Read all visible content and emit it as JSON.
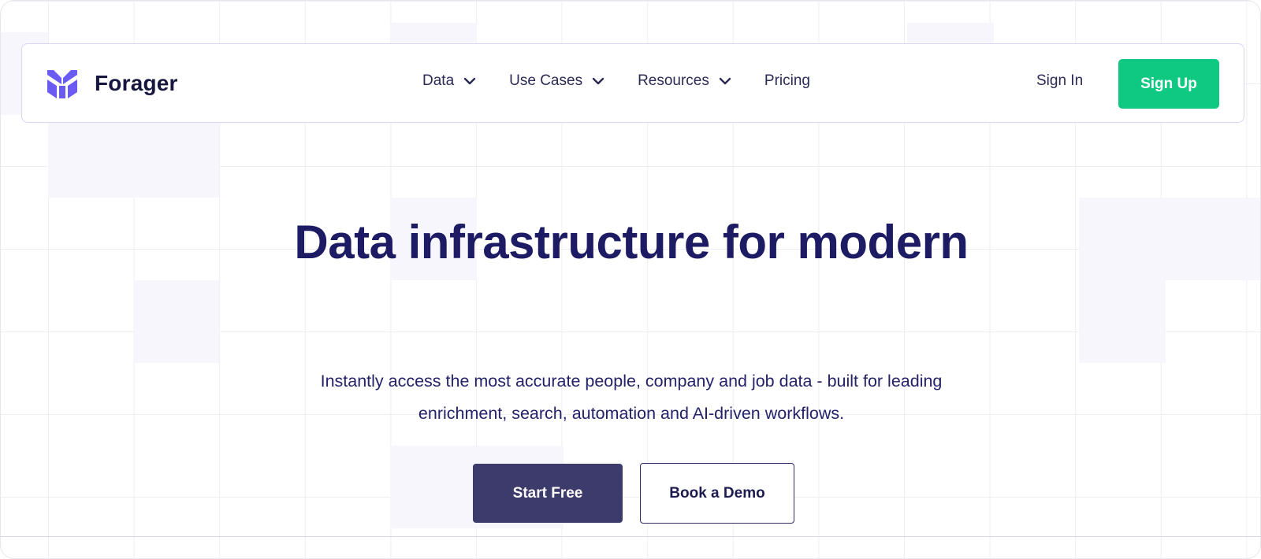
{
  "brand": {
    "name": "Forager",
    "logo_icon": "forager-logo-icon",
    "logo_color": "#6a5cf3"
  },
  "nav": {
    "items": [
      {
        "label": "Data",
        "has_dropdown": true
      },
      {
        "label": "Use Cases",
        "has_dropdown": true
      },
      {
        "label": "Resources",
        "has_dropdown": true
      },
      {
        "label": "Pricing",
        "has_dropdown": false
      }
    ],
    "sign_in": "Sign In",
    "sign_up": "Sign Up"
  },
  "hero": {
    "headline": "Data infrastructure for modern",
    "subtext": "Instantly access the most accurate people, company and job data - built for leading enrichment, search, automation and AI-driven workflows.",
    "primary_cta": "Start Free",
    "secondary_cta": "Book a Demo"
  },
  "colors": {
    "accent_green": "#0fc882",
    "primary_dark": "#3d3a6c",
    "heading": "#1d1b63"
  }
}
